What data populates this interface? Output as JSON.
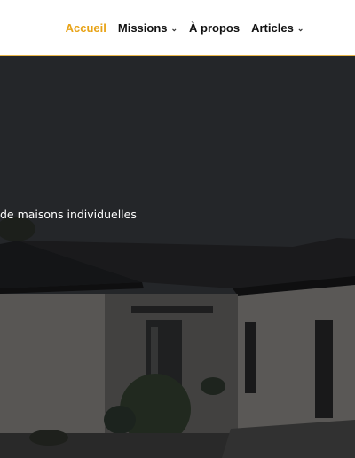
{
  "nav": {
    "items": [
      {
        "label": "Accueil",
        "active": true,
        "has_dropdown": false
      },
      {
        "label": "Missions",
        "active": false,
        "has_dropdown": true
      },
      {
        "label": "À propos",
        "active": false,
        "has_dropdown": false
      },
      {
        "label": "Articles",
        "active": false,
        "has_dropdown": true
      }
    ],
    "dropdown_icon": "chevron-down-icon",
    "accent_color": "#e8a317",
    "border_color": "#e9b64a"
  },
  "hero": {
    "subtitle": "de maisons individuelles"
  }
}
